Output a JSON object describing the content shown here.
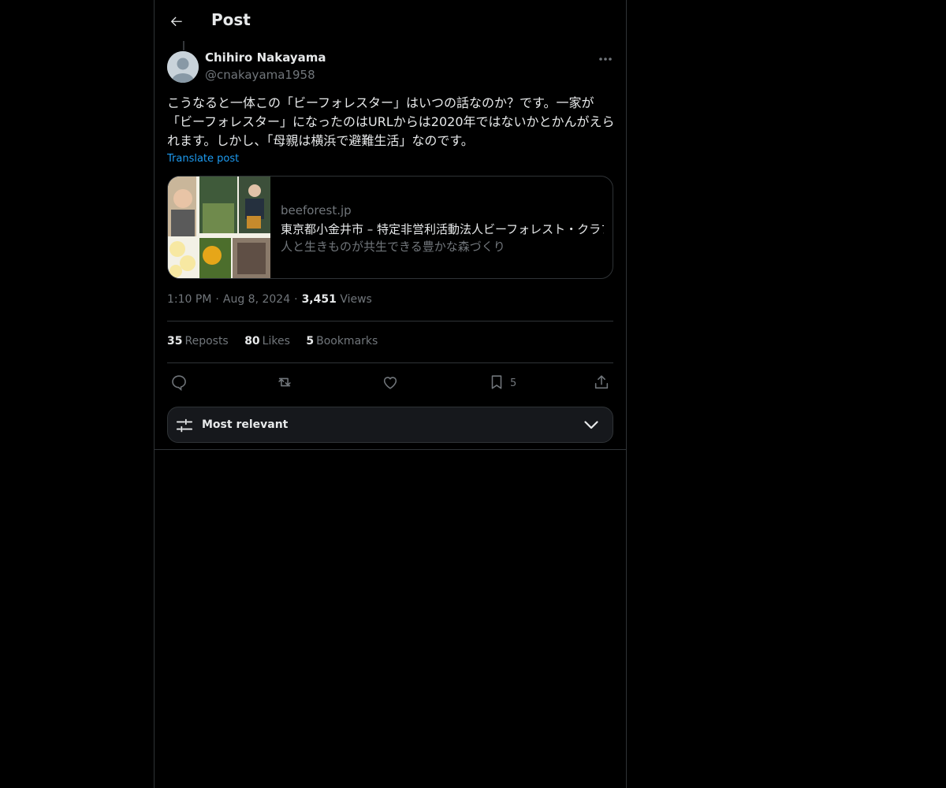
{
  "header": {
    "title": "Post",
    "back_icon": "arrow-left-icon"
  },
  "post": {
    "author_name": "Chihiro Nakayama",
    "author_handle": "@cnakayama1958",
    "text": "こうなると一体この「ビーフォレスター」はいつの話なのか？です。一家が「ビーフォレスター」になったのはURLからは2020年ではないかとかんがえられます。しかし、「母親は横浜で避難生活」なのです。",
    "translate_label": "Translate post",
    "card": {
      "domain": "beeforest.jp",
      "title": "東京都小金井市 – 特定非営利活動法人ビーフォレスト・クラブ",
      "description": "人と生きものが共生できる豊かな森づくり"
    },
    "time": "1:10 PM",
    "date": "Aug 8, 2024",
    "views_count": "3,451",
    "views_label": "Views",
    "separator": "·"
  },
  "stats": {
    "reposts_count": "35",
    "reposts_label": "Reposts",
    "likes_count": "80",
    "likes_label": "Likes",
    "bookmarks_count": "5",
    "bookmarks_label": "Bookmarks"
  },
  "actions": {
    "reply_icon": "reply-icon",
    "repost_icon": "repost-icon",
    "like_icon": "heart-icon",
    "bookmark_icon": "bookmark-icon",
    "bookmark_count": "5",
    "share_icon": "share-icon"
  },
  "sort": {
    "label": "Most relevant",
    "icon": "sliders-icon",
    "chevron": "chevron-down-icon"
  },
  "colors": {
    "background": "#000000",
    "text": "#e7e9ea",
    "secondary": "#71767b",
    "accent": "#1d9bf0",
    "border": "#2f3336"
  }
}
